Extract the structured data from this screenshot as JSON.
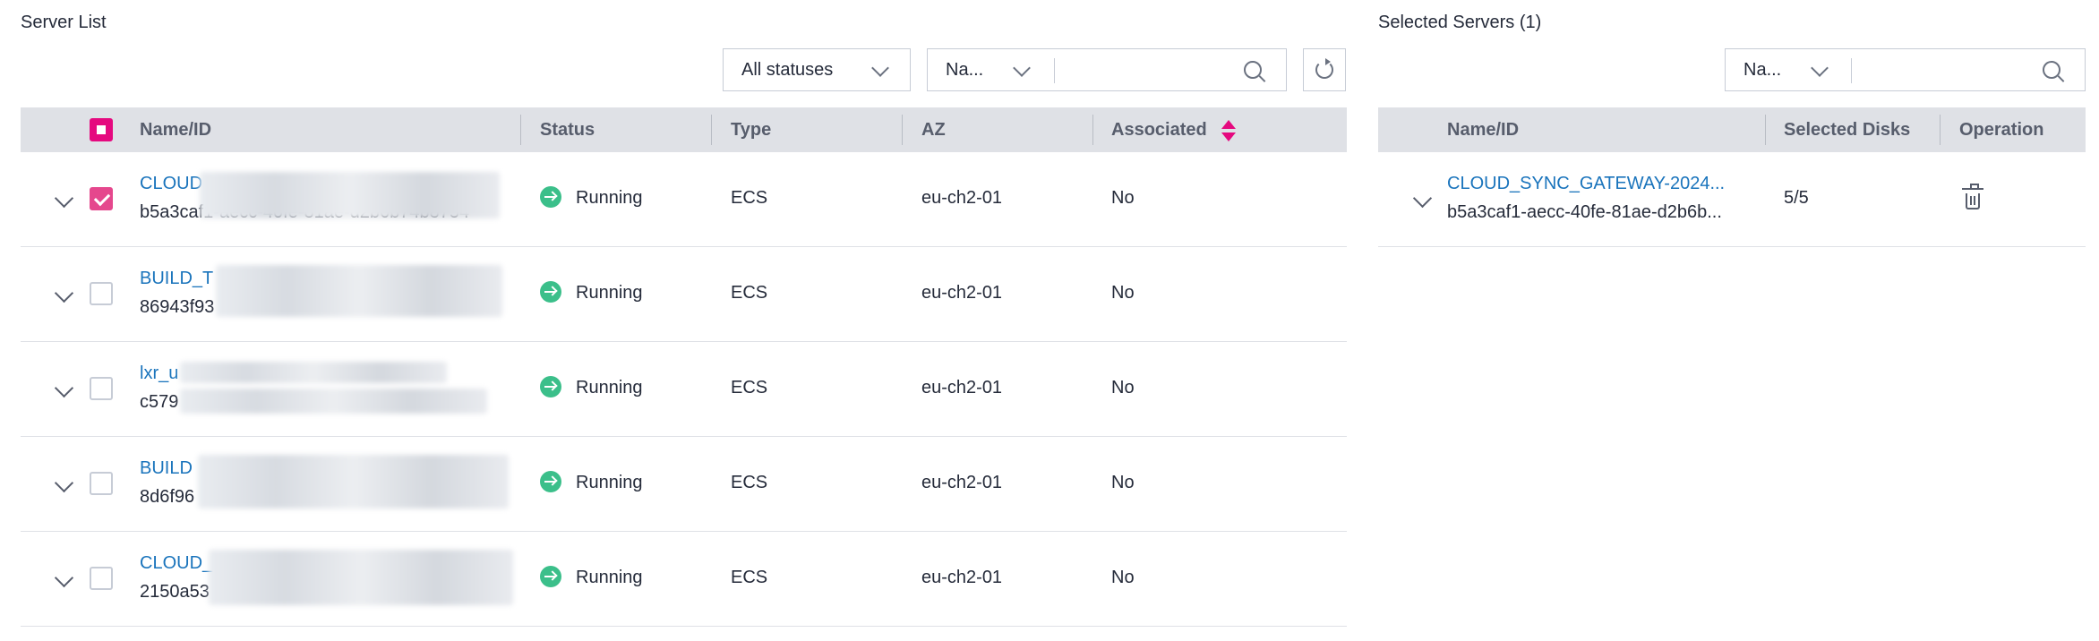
{
  "left_panel": {
    "title": "Server List",
    "status_filter": {
      "selected": "All statuses"
    },
    "search": {
      "filter_label": "Na...",
      "placeholder": ""
    },
    "columns": [
      "Name/ID",
      "Status",
      "Type",
      "AZ",
      "Associated"
    ],
    "rows": [
      {
        "name": "CLOUD",
        "id": "b5a3caf1-aecc-40fe-81ae-d2b6b74b8754",
        "status": "Running",
        "type": "ECS",
        "az": "eu-ch2-01",
        "associated": "No",
        "checked": true
      },
      {
        "name": "BUILD_T",
        "id": "86943f93",
        "status": "Running",
        "type": "ECS",
        "az": "eu-ch2-01",
        "associated": "No",
        "checked": false
      },
      {
        "name": "lxr_u",
        "id": "c579",
        "status": "Running",
        "type": "ECS",
        "az": "eu-ch2-01",
        "associated": "No",
        "checked": false
      },
      {
        "name": "BUILD",
        "id": "8d6f96",
        "status": "Running",
        "type": "ECS",
        "az": "eu-ch2-01",
        "associated": "No",
        "checked": false
      },
      {
        "name": "CLOUD_",
        "id": "2150a53",
        "status": "Running",
        "type": "ECS",
        "az": "eu-ch2-01",
        "associated": "No",
        "checked": false
      }
    ]
  },
  "right_panel": {
    "title": "Selected Servers (1)",
    "search": {
      "filter_label": "Na...",
      "placeholder": ""
    },
    "columns": [
      "Name/ID",
      "Selected Disks",
      "Operation"
    ],
    "rows": [
      {
        "name": "CLOUD_SYNC_GATEWAY-2024...",
        "id": "b5a3caf1-aecc-40fe-81ae-d2b6b...",
        "selected_disks": "5/5"
      }
    ]
  },
  "icons": {
    "status": "running-arrow-icon",
    "sort": "sort-icon",
    "delete": "trash-icon",
    "refresh": "refresh-icon",
    "search": "search-icon",
    "expand": "chevron-down-icon"
  },
  "colors": {
    "accent": "#e5097f",
    "link": "#1a74bc",
    "running": "#3bbf8a",
    "header_bg": "#dfe1e6"
  }
}
